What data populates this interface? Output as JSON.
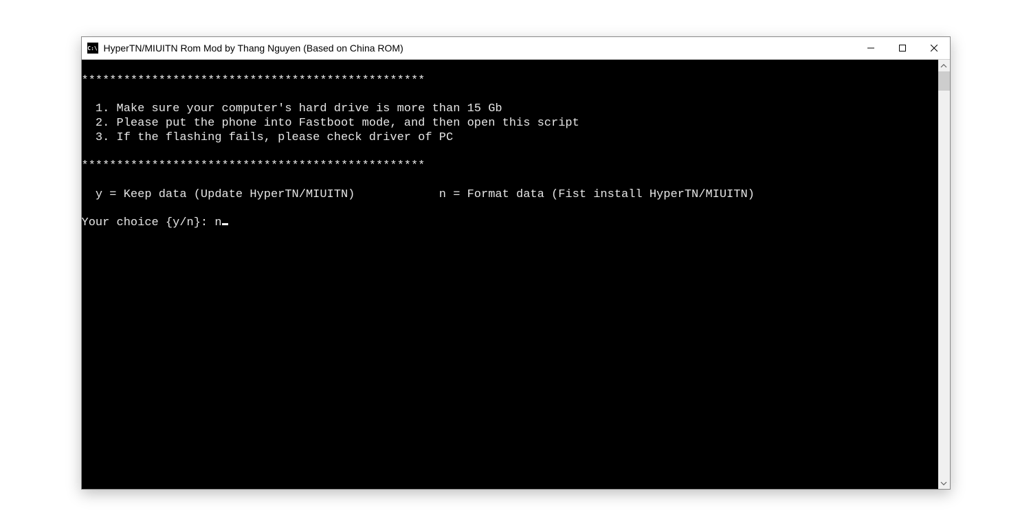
{
  "window": {
    "icon_label": "C:\\",
    "title": "HyperTN/MIUITN Rom Mod by Thang Nguyen (Based on China ROM)"
  },
  "terminal": {
    "sep": "*************************************************",
    "blank": "",
    "inst1": "  1. Make sure your computer's hard drive is more than 15 Gb",
    "inst2": "  2. Please put the phone into Fastboot mode, and then open this script",
    "inst3": "  3. If the flashing fails, please check driver of PC",
    "opts": "  y = Keep data (Update HyperTN/MIUITN)            n = Format data (Fist install HyperTN/MIUITN)",
    "prompt": "Your choice {y/n}: ",
    "input": "n"
  }
}
